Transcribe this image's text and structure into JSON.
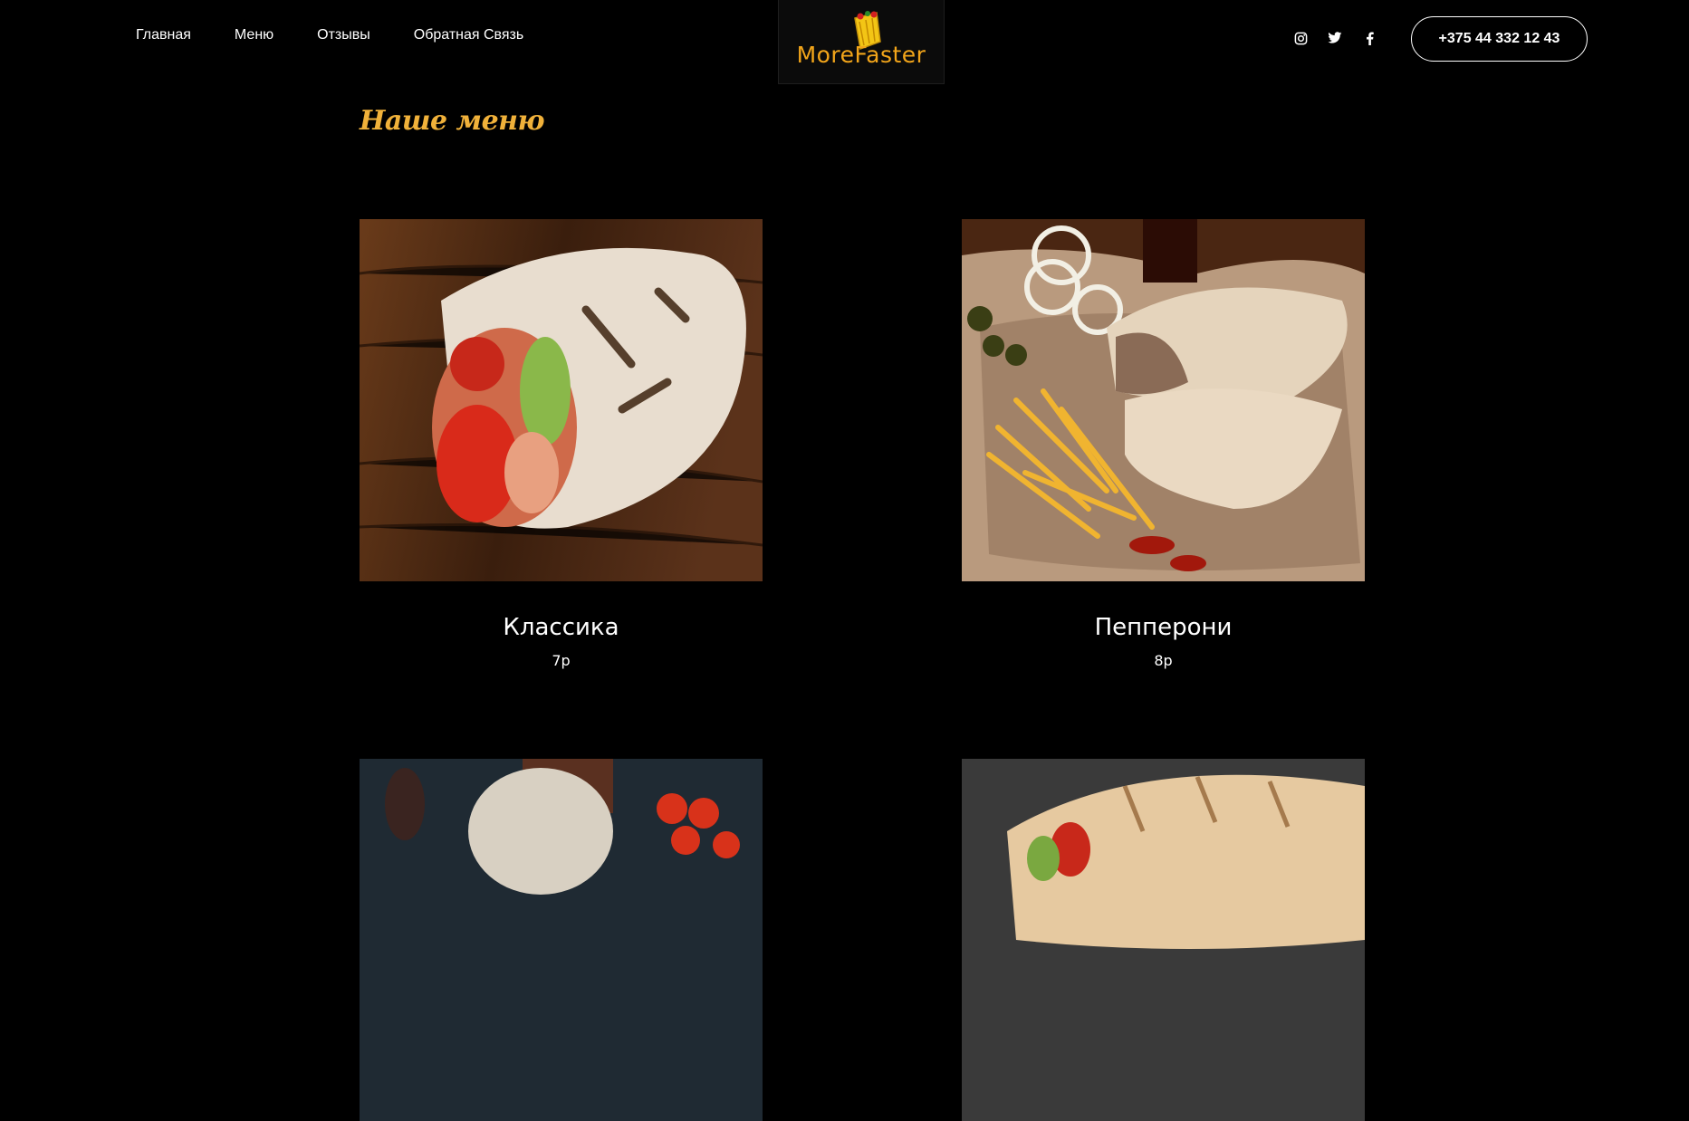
{
  "nav": {
    "items": [
      {
        "label": "Главная"
      },
      {
        "label": "Меню"
      },
      {
        "label": "Отзывы"
      },
      {
        "label": "Обратная Связь"
      }
    ]
  },
  "logo": {
    "text": "MoreFaster"
  },
  "social": [
    "instagram-icon",
    "twitter-icon",
    "facebook-icon"
  ],
  "phone": {
    "label": "+375 44 332 12 43"
  },
  "menu": {
    "title": "Наше меню",
    "items": [
      {
        "name": "Классика",
        "price": "7р"
      },
      {
        "name": "Пепперони",
        "price": "8р"
      }
    ]
  },
  "colors": {
    "accent": "#f0b13a",
    "logo": "#f2a51a",
    "background": "#000000"
  }
}
